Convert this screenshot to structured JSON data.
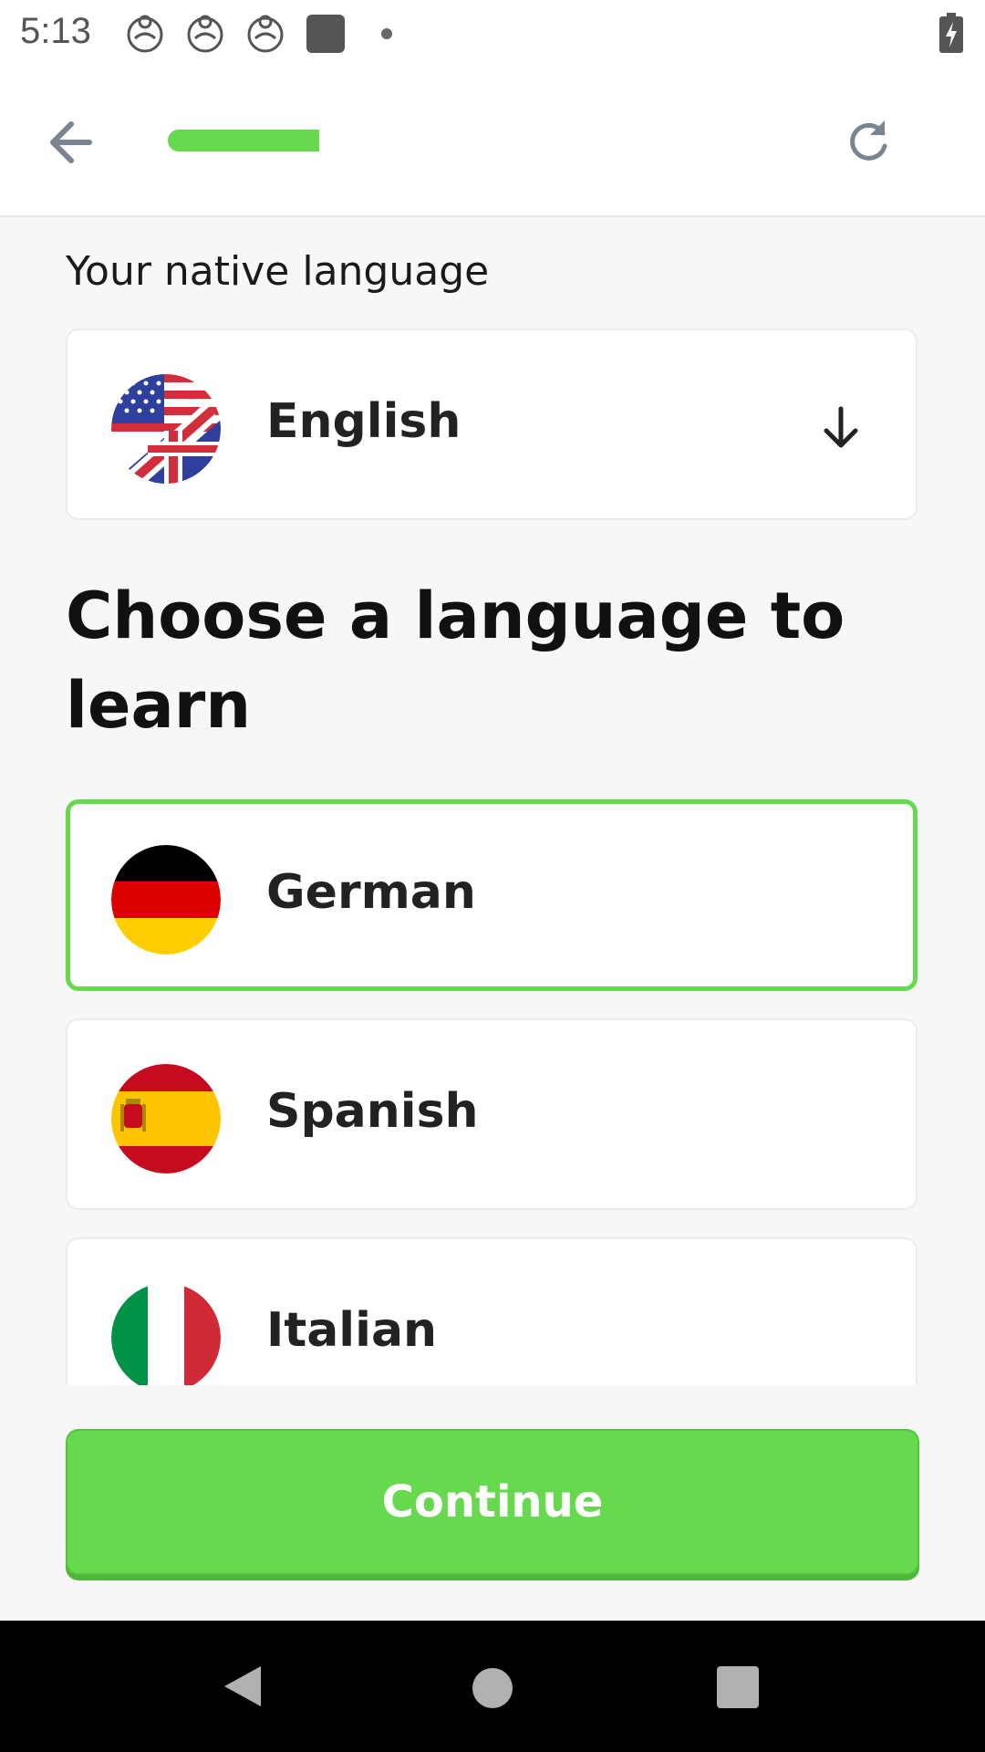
{
  "status_bar": {
    "time": "5:13",
    "icons": [
      "baby-app-icon",
      "baby-app-icon",
      "baby-app-icon",
      "square-app-icon",
      "dot-icon",
      "battery-charging-icon"
    ]
  },
  "app_bar": {
    "back_icon": "arrow-left-icon",
    "progress": 0.2,
    "refresh_icon": "refresh-icon"
  },
  "native_language": {
    "label": "Your native language",
    "selected": "English",
    "flag": "us-uk-flag-icon",
    "dropdown_icon": "arrow-down-icon"
  },
  "learn": {
    "heading": "Choose a language to learn",
    "options": [
      {
        "label": "German",
        "flag": "germany-flag-icon",
        "selected": true
      },
      {
        "label": "Spanish",
        "flag": "spain-flag-icon",
        "selected": false
      },
      {
        "label": "Italian",
        "flag": "italy-flag-icon",
        "selected": false
      }
    ]
  },
  "continue_label": "Continue",
  "colors": {
    "accent": "#66d94f",
    "background": "#f7f7f7",
    "card": "#ffffff"
  },
  "nav_bar": {
    "icons": [
      "nav-back-icon",
      "nav-home-icon",
      "nav-recents-icon"
    ]
  }
}
